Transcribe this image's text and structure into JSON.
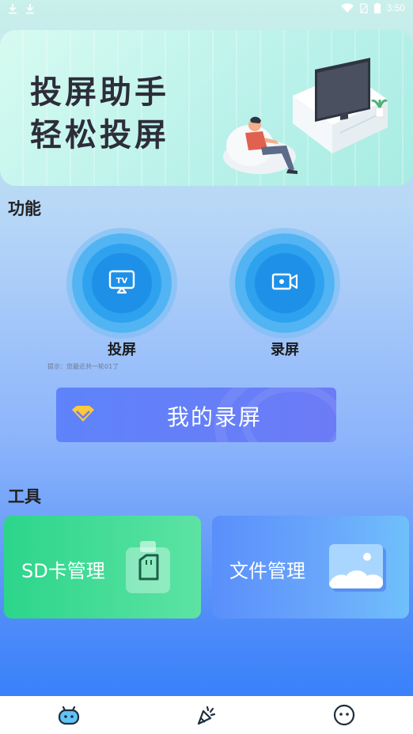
{
  "status_bar": {
    "time": "3:50"
  },
  "banner": {
    "line1": "投屏助手",
    "line2": "轻松投屏"
  },
  "sections": {
    "functions": "功能",
    "tools": "工具"
  },
  "functions": [
    {
      "label": "投屏",
      "icon": "tv-cast-icon"
    },
    {
      "label": "录屏",
      "icon": "video-record-icon"
    }
  ],
  "hint": "提示：您最近共一轮01了",
  "my_recordings": {
    "label": "我的录屏",
    "icon": "diamond-icon"
  },
  "tools": [
    {
      "label": "SD卡管理",
      "icon": "sd-card-icon",
      "color_start": "#2cd58b",
      "color_end": "#5de3a4"
    },
    {
      "label": "文件管理",
      "icon": "image-file-icon",
      "color_start": "#5a8ffb",
      "color_end": "#6fc0fb"
    }
  ],
  "nav": [
    {
      "name": "home",
      "icon": "robot-face-icon"
    },
    {
      "name": "discover",
      "icon": "party-popper-icon"
    },
    {
      "name": "profile",
      "icon": "smiley-icon"
    }
  ],
  "colors": {
    "accent": "#2e8ff0",
    "nav_icon": "#1f2d3d"
  }
}
